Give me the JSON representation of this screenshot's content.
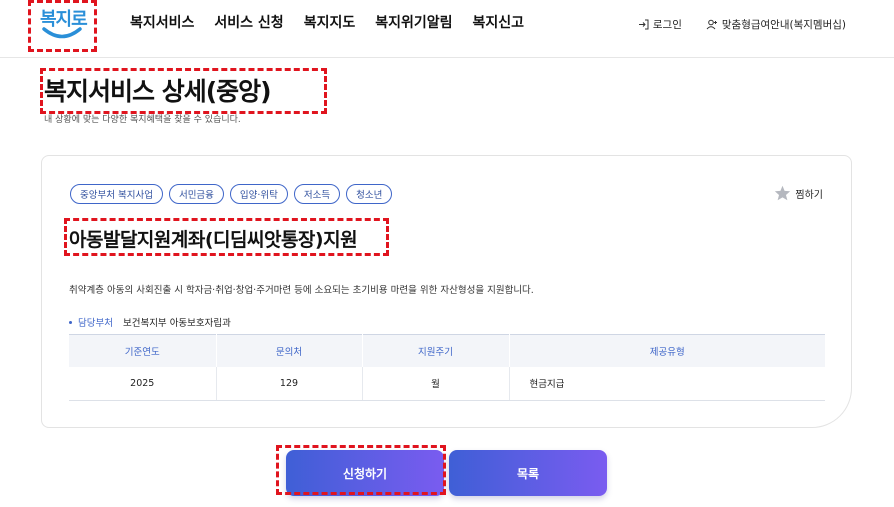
{
  "header": {
    "logo_text": "복지로",
    "nav": [
      "복지서비스",
      "서비스 신청",
      "복지지도",
      "복지위기알림",
      "복지신고"
    ],
    "login": "로그인",
    "membership": "맞춤형급여안내(복지멤버십)"
  },
  "page": {
    "title": "복지서비스 상세(중앙)",
    "subtitle": "내 상황에 맞는 다양한 복지혜택을 찾을 수 있습니다."
  },
  "card": {
    "tags": [
      "중앙부처 복지사업",
      "서민금융",
      "입양·위탁",
      "저소득",
      "청소년"
    ],
    "bookmark": "찜하기",
    "title": "아동발달지원계좌(디딤씨앗통장)지원",
    "description": "취약계층 아동의 사회진출 시 학자금·취업·창업·주거마련 등에 소요되는 초기비용 마련을 위한 자산형성을 지원합니다.",
    "dept_label": "담당부처",
    "dept_value": "보건복지부 아동보호자립과",
    "table": {
      "headers": [
        "기준연도",
        "문의처",
        "지원주기",
        "제공유형"
      ],
      "row": [
        "2025",
        "129",
        "월",
        "현금지급"
      ]
    }
  },
  "buttons": {
    "apply": "신청하기",
    "list": "목록"
  },
  "colors": {
    "accent": "#3f66c9",
    "button_start": "#3f5fd6",
    "button_end": "#7a5cf0",
    "highlight": "#e0141e"
  }
}
